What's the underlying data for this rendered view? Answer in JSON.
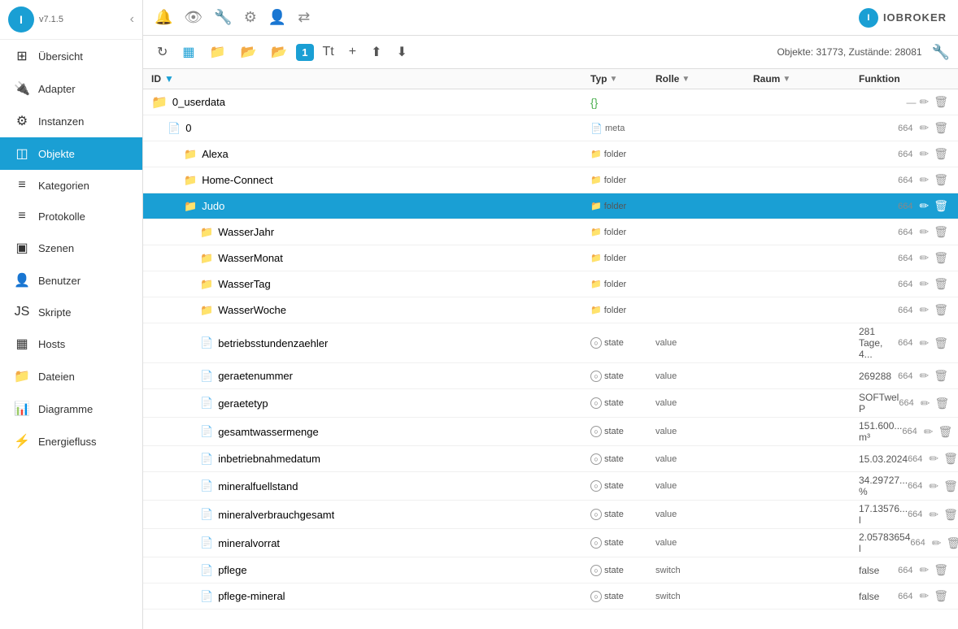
{
  "sidebar": {
    "logo": "I",
    "version": "v7.1.5",
    "items": [
      {
        "id": "ubersicht",
        "label": "Übersicht",
        "icon": "⊞"
      },
      {
        "id": "adapter",
        "label": "Adapter",
        "icon": "🔌"
      },
      {
        "id": "instanzen",
        "label": "Instanzen",
        "icon": "⚙"
      },
      {
        "id": "objekte",
        "label": "Objekte",
        "icon": "◫",
        "active": true
      },
      {
        "id": "kategorien",
        "label": "Kategorien",
        "icon": "≡"
      },
      {
        "id": "protokolle",
        "label": "Protokolle",
        "icon": "≡"
      },
      {
        "id": "szenen",
        "label": "Szenen",
        "icon": "▣"
      },
      {
        "id": "benutzer",
        "label": "Benutzer",
        "icon": "👤"
      },
      {
        "id": "skripte",
        "label": "Skripte",
        "icon": "JS"
      },
      {
        "id": "hosts",
        "label": "Hosts",
        "icon": "▦"
      },
      {
        "id": "dateien",
        "label": "Dateien",
        "icon": "📁"
      },
      {
        "id": "diagramme",
        "label": "Diagramme",
        "icon": "📊"
      },
      {
        "id": "energiefluss",
        "label": "Energiefluss",
        "icon": "⚡"
      }
    ]
  },
  "topbar": {
    "brand": "IOBROKER",
    "icons": [
      "bell",
      "eye",
      "wrench",
      "brightness",
      "person",
      "exchange"
    ]
  },
  "toolbar": {
    "status": "Objekte: 31773, Zustände: 28081",
    "buttons": [
      "refresh",
      "chart",
      "folder",
      "folder-open",
      "folder-blue",
      "badge1",
      "text",
      "plus",
      "upload",
      "download"
    ]
  },
  "table": {
    "headers": [
      "ID",
      "Typ",
      "Rolle",
      "Raum",
      "Funktion"
    ],
    "rows": [
      {
        "indent": 0,
        "name": "0_userdata",
        "type": "curly",
        "value": "{}",
        "perms": "—",
        "isFolder": true,
        "green": true
      },
      {
        "indent": 1,
        "name": "0",
        "type": "doc",
        "value": "meta",
        "perms": "664",
        "isFolder": false
      },
      {
        "indent": 2,
        "name": "Alexa",
        "type": "folder-sm",
        "typeLabel": "folder",
        "perms": "664",
        "isFolder": true
      },
      {
        "indent": 2,
        "name": "Home-Connect",
        "type": "folder-sm",
        "typeLabel": "folder",
        "perms": "664",
        "isFolder": true
      },
      {
        "indent": 2,
        "name": "Judo",
        "type": "folder-sm",
        "typeLabel": "folder",
        "perms": "664",
        "isFolder": true,
        "selected": true
      },
      {
        "indent": 3,
        "name": "WasserJahr",
        "type": "folder-sm",
        "typeLabel": "folder",
        "perms": "664",
        "isFolder": true
      },
      {
        "indent": 3,
        "name": "WasserMonat",
        "type": "folder-sm",
        "typeLabel": "folder",
        "perms": "664",
        "isFolder": true
      },
      {
        "indent": 3,
        "name": "WasserTag",
        "type": "folder-sm",
        "typeLabel": "folder",
        "perms": "664",
        "isFolder": true
      },
      {
        "indent": 3,
        "name": "WasserWoche",
        "type": "folder-sm",
        "typeLabel": "folder",
        "perms": "664",
        "isFolder": true
      },
      {
        "indent": 3,
        "name": "betriebsstundenzaehler",
        "typeLabel": "state",
        "roleLabel": "value",
        "perms": "664",
        "value": "281 Tage, 4...",
        "isFolder": false,
        "hasSettings": false
      },
      {
        "indent": 3,
        "name": "geraetenummer",
        "typeLabel": "state",
        "roleLabel": "value",
        "perms": "664",
        "value": "269288",
        "isFolder": false,
        "hasSettings": false
      },
      {
        "indent": 3,
        "name": "geraetetyp",
        "typeLabel": "state",
        "roleLabel": "value",
        "perms": "664",
        "value": "SOFTwel P",
        "isFolder": false,
        "hasSettings": false
      },
      {
        "indent": 3,
        "name": "gesamtwassermenge",
        "typeLabel": "state",
        "roleLabel": "value",
        "perms": "664",
        "value": "151.600... m³",
        "isFolder": false,
        "hasSettings": true
      },
      {
        "indent": 3,
        "name": "inbetriebnahmedatum",
        "typeLabel": "state",
        "roleLabel": "value",
        "perms": "664",
        "value": "15.03.2024",
        "isFolder": false,
        "hasSettings": false
      },
      {
        "indent": 3,
        "name": "mineralfuellstand",
        "typeLabel": "state",
        "roleLabel": "value",
        "perms": "664",
        "value": "34.29727... %",
        "isFolder": false,
        "hasSettings": true
      },
      {
        "indent": 3,
        "name": "mineralverbrauchgesamt",
        "typeLabel": "state",
        "roleLabel": "value",
        "perms": "664",
        "value": "17.13576... l",
        "isFolder": false,
        "hasSettings": true
      },
      {
        "indent": 3,
        "name": "mineralvorrat",
        "typeLabel": "state",
        "roleLabel": "value",
        "perms": "664",
        "value": "2.05783654 l",
        "isFolder": false,
        "hasSettings": false
      },
      {
        "indent": 3,
        "name": "pflege",
        "typeLabel": "state",
        "roleLabel": "switch",
        "perms": "664",
        "value": "false",
        "isFolder": false,
        "hasSettings": false
      },
      {
        "indent": 3,
        "name": "pflege-mineral",
        "typeLabel": "state",
        "roleLabel": "switch",
        "perms": "664",
        "value": "false",
        "isFolder": false,
        "hasSettings": false
      }
    ]
  }
}
